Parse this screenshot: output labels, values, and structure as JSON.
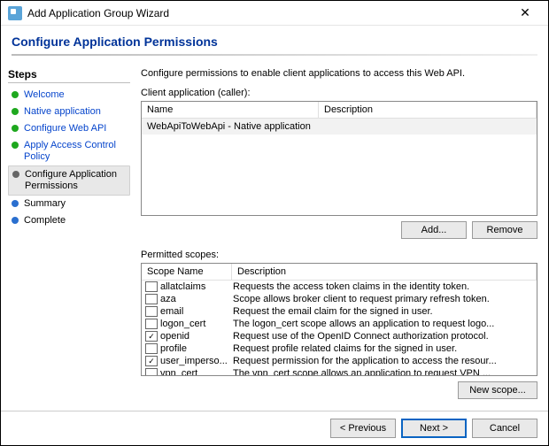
{
  "window": {
    "title": "Add Application Group Wizard"
  },
  "header": {
    "title": "Configure Application Permissions"
  },
  "sidebar": {
    "label": "Steps",
    "items": [
      {
        "label": "Welcome",
        "state": "done",
        "link": true
      },
      {
        "label": "Native application",
        "state": "done",
        "link": true
      },
      {
        "label": "Configure Web API",
        "state": "done",
        "link": true
      },
      {
        "label": "Apply Access Control Policy",
        "state": "done",
        "link": true
      },
      {
        "label": "Configure Application Permissions",
        "state": "current",
        "link": false
      },
      {
        "label": "Summary",
        "state": "todo",
        "link": false
      },
      {
        "label": "Complete",
        "state": "todo",
        "link": false
      }
    ]
  },
  "main": {
    "description": "Configure permissions to enable client applications to access this Web API.",
    "client_label": "Client application (caller):",
    "client_columns": {
      "name": "Name",
      "description": "Description"
    },
    "client_rows": [
      {
        "name": "WebApiToWebApi - Native application",
        "description": ""
      }
    ],
    "add_label": "Add...",
    "remove_label": "Remove",
    "permitted_label": "Permitted scopes:",
    "scope_columns": {
      "name": "Scope Name",
      "description": "Description"
    },
    "scopes": [
      {
        "checked": false,
        "name": "allatclaims",
        "description": "Requests the access token claims in the identity token."
      },
      {
        "checked": false,
        "name": "aza",
        "description": "Scope allows broker client to request primary refresh token."
      },
      {
        "checked": false,
        "name": "email",
        "description": "Request the email claim for the signed in user."
      },
      {
        "checked": false,
        "name": "logon_cert",
        "description": "The logon_cert scope allows an application to request logo..."
      },
      {
        "checked": true,
        "name": "openid",
        "description": "Request use of the OpenID Connect authorization protocol."
      },
      {
        "checked": false,
        "name": "profile",
        "description": "Request profile related claims for the signed in user."
      },
      {
        "checked": true,
        "name": "user_imperso...",
        "description": "Request permission for the application to access the resour..."
      },
      {
        "checked": false,
        "name": "vpn_cert",
        "description": "The vpn_cert scope allows an application to request VPN ..."
      }
    ],
    "new_scope_label": "New scope..."
  },
  "footer": {
    "previous": "< Previous",
    "next": "Next >",
    "cancel": "Cancel"
  }
}
